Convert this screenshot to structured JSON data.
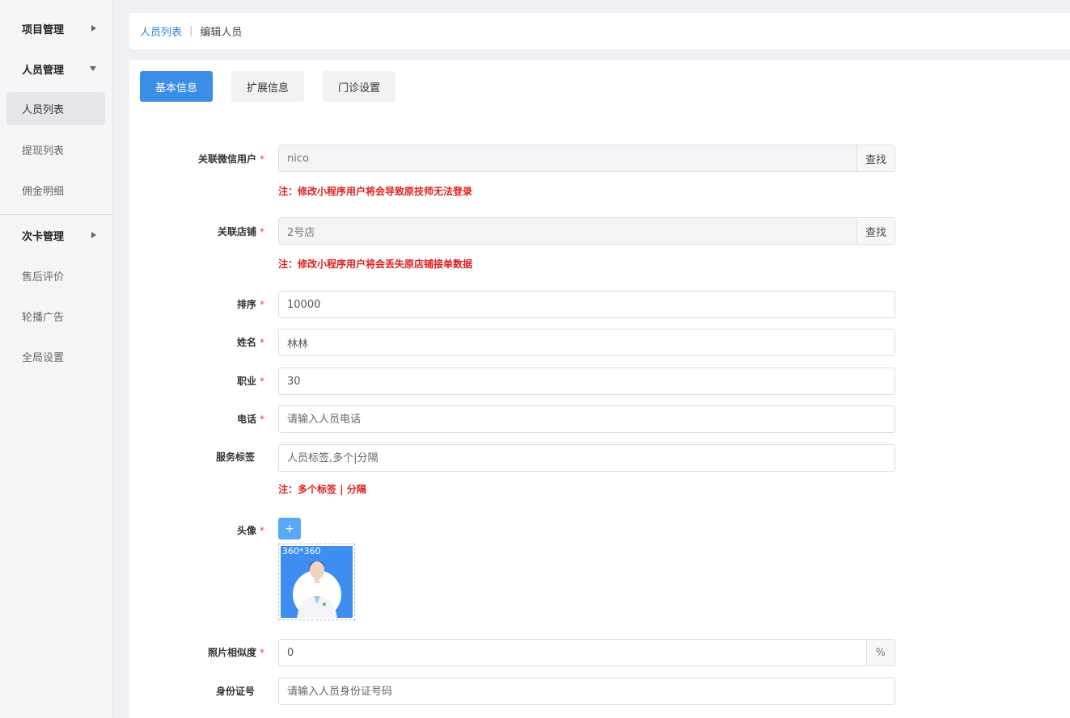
{
  "sidebar": {
    "groups": [
      {
        "label": "项目管理"
      },
      {
        "label": "人员管理"
      },
      {
        "label": "次卡管理"
      }
    ],
    "items": [
      {
        "label": "人员列表"
      },
      {
        "label": "提现列表"
      },
      {
        "label": "佣金明细"
      },
      {
        "label": "售后评价"
      },
      {
        "label": "轮播广告"
      },
      {
        "label": "全局设置"
      }
    ]
  },
  "breadcrumb": {
    "parent": "人员列表",
    "separator": "|",
    "current": "编辑人员"
  },
  "tabs": [
    {
      "label": "基本信息",
      "active": true
    },
    {
      "label": "扩展信息",
      "active": false
    },
    {
      "label": "门诊设置",
      "active": false
    }
  ],
  "form": {
    "wechat_user": {
      "label": "关联微信用户",
      "value": "nico",
      "button": "查找",
      "note": "注：修改小程序用户将会导致原技师无法登录"
    },
    "store": {
      "label": "关联店铺",
      "value": "2号店",
      "button": "查找",
      "note": "注：修改小程序用户将会丢失原店铺接单数据"
    },
    "sort": {
      "label": "排序",
      "value": "10000"
    },
    "name": {
      "label": "姓名",
      "value": "林林"
    },
    "job": {
      "label": "职业",
      "value": "30"
    },
    "phone": {
      "label": "电话",
      "placeholder": "请输入人员电话"
    },
    "tags": {
      "label": "服务标签",
      "placeholder": "人员标签,多个|分隔",
      "note": "注：多个标签 | 分隔"
    },
    "avatar": {
      "label": "头像",
      "add_button": "+",
      "caption": "360*360"
    },
    "similarity": {
      "label": "照片相似度",
      "value": "0",
      "unit": "%"
    },
    "id_card": {
      "label": "身份证号",
      "placeholder": "请输入人员身份证号码"
    }
  },
  "required_mark": "*",
  "colors": {
    "primary": "#3a8ee6",
    "link": "#2f86d6",
    "error_note": "#e02020",
    "avatar_bg": "#3d8ef0"
  }
}
